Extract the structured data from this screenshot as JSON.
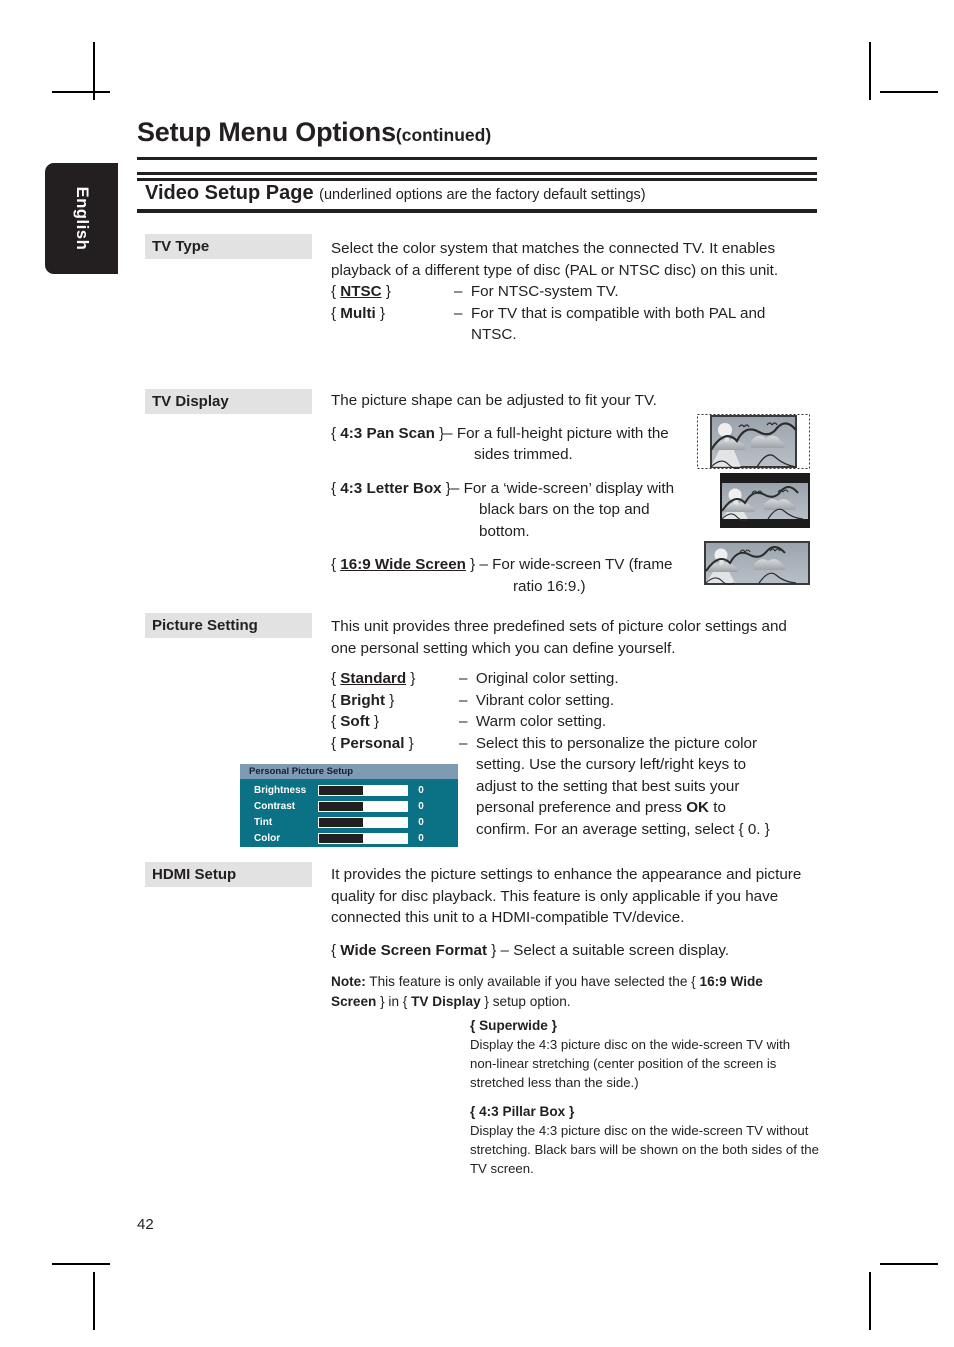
{
  "language_tab": {
    "label": "English"
  },
  "header": {
    "title": "Setup Menu Options",
    "continued": "(continued)",
    "banner_title": "Video Setup Page",
    "banner_note": "(underlined options are the factory default settings)"
  },
  "sections": [
    {
      "label": "TV Type",
      "intro": "Select the color system that matches the connected TV.  It enables playback of a different type of disc (PAL or NTSC disc) on this unit.",
      "options": [
        {
          "key": "{ NTSC }",
          "name": "NTSC",
          "underlined": true,
          "dash": "–",
          "desc": "For NTSC-system TV."
        },
        {
          "key": "{ Multi }",
          "name": "Multi",
          "underlined": false,
          "dash": "–",
          "desc": "For TV that is compatible with both PAL and NTSC."
        }
      ]
    },
    {
      "label": "TV Display",
      "intro": "The picture shape can be adjusted to fit your TV.",
      "options": [
        {
          "key": "{ 4:3 Pan Scan }",
          "name": "4:3 Pan Scan",
          "underlined": false,
          "dash": "–",
          "desc": "For a full-height picture with the sides trimmed.",
          "thumb": "pan-scan-thumbnail"
        },
        {
          "key": "{ 4:3 Letter Box }",
          "name": "4:3 Letter Box",
          "underlined": false,
          "dash": "–",
          "desc": "For a ‘wide-screen’ display with black bars on the top and bottom.",
          "thumb": "letter-box-thumbnail"
        },
        {
          "key": "{ 16:9 Wide Screen }",
          "name": "16:9 Wide Screen",
          "underlined": true,
          "dash": "–",
          "desc": "For wide-screen TV (frame ratio 16:9.)",
          "thumb": "wide-screen-thumbnail"
        }
      ]
    },
    {
      "label": "Picture Setting",
      "intro": "This unit provides three predefined sets of picture color settings and one personal setting which you can define yourself.",
      "options": [
        {
          "key": "{ Standard }",
          "name": "Standard",
          "underlined": true,
          "dash": "–",
          "desc": "Original color setting."
        },
        {
          "key": "{ Bright }",
          "name": "Bright",
          "underlined": false,
          "dash": "–",
          "desc": "Vibrant color setting."
        },
        {
          "key": "{ Soft }",
          "name": "Soft",
          "underlined": false,
          "dash": "–",
          "desc": "Warm color setting."
        },
        {
          "key": "{ Personal }",
          "name": "Personal",
          "underlined": false,
          "dash": "–",
          "desc": "Select this to personalize the picture color setting. Use the cursory left/right keys to adjust to the setting that best suits your personal preference and press OK to confirm.  For an average setting, select { 0. }"
        }
      ]
    },
    {
      "label": "HDMI Setup",
      "intro": "It provides the picture settings to enhance the appearance and picture quality for disc playback.  This feature is only applicable if you have connected this unit to a HDMI-compatible TV/device."
    }
  ],
  "personal_text": {
    "line1a": "{ ",
    "personal": "Personal",
    "line1b": " }",
    "dash": "–",
    "part1": "Select this to personalize the picture color",
    "part2": "setting. Use the cursory left/right keys to",
    "part3": "adjust to the setting that best suits your",
    "part4a": "personal preference and press ",
    "ok": "OK",
    "part4b": " to",
    "part5": "confirm.  For an average setting, select { 0. }"
  },
  "osd": {
    "title": "Personal Picture Setup",
    "rows": [
      {
        "name": "Brightness",
        "value": "0",
        "fill_percent": 50
      },
      {
        "name": "Contrast",
        "value": "0",
        "fill_percent": 50
      },
      {
        "name": "Tint",
        "value": "0",
        "fill_percent": 50
      },
      {
        "name": "Color",
        "value": "0",
        "fill_percent": 50
      }
    ],
    "title_bg": "#7d9bb3",
    "body_bg": "#0b7285"
  },
  "hdmi": {
    "wide_screen_format_key": "{ Wide Screen Format }",
    "wide_screen_format_name": "Wide Screen Format",
    "wide_screen_format_desc": "– Select a suitable screen display.",
    "note_label": "Note:",
    "note_text_a": "  This feature is only available if you have selected the { ",
    "note_bold_a": "16:9 Wide Screen",
    "note_text_b": " } in { ",
    "note_bold_b": "TV Display",
    "note_text_c": " } setup option."
  },
  "sub_options": [
    {
      "heading_key": "{ Superwide }",
      "heading_name": "Superwide",
      "body": "Display the 4:3 picture disc on the wide-screen TV with non-linear stretching (center position of the screen is stretched less than the side.)"
    },
    {
      "heading_key": "{ 4:3 Pillar Box }",
      "heading_name": "4:3 Pillar Box",
      "body": "Display the 4:3 picture disc on the wide-screen TV without stretching.  Black bars will be shown on the both sides of the TV screen."
    }
  ],
  "page_number": "42",
  "colors": {
    "label_bg": "#e2e2e2",
    "ink": "#231f20",
    "osd_teal": "#0b7285",
    "osd_titlebar": "#7d9bb3"
  }
}
